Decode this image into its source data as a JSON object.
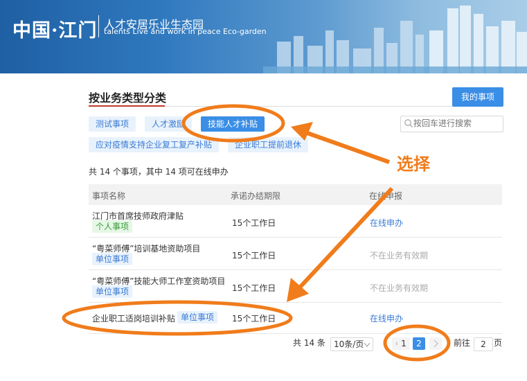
{
  "header": {
    "logo": "中国·江门",
    "slogan_cn": "人才安居乐业生态园",
    "slogan_en": "talents Live and work in peace Eco-garden"
  },
  "section": {
    "title": "按业务类型分类",
    "my_items_button": "我的事项"
  },
  "tags": [
    {
      "label": "测试事项",
      "active": false
    },
    {
      "label": "人才激励",
      "active": false
    },
    {
      "label": "技能人才补贴",
      "active": true
    },
    {
      "label": "应对疫情支持企业复工复产补贴",
      "active": false
    },
    {
      "label": "企业职工提前退休",
      "active": false
    }
  ],
  "search": {
    "placeholder": "按回车进行搜索"
  },
  "summary": "共 14 个事项，其中 14 项可在线申办",
  "table": {
    "headers": [
      "事项名称",
      "承诺办结期限",
      "在线申报"
    ],
    "rows": [
      {
        "name": "江门市首席技师政府津贴",
        "badge": "个人事项",
        "deadline": "15个工作日",
        "action": "在线申办"
      },
      {
        "name": "“粤菜师傅”培训基地资助项目",
        "badge": "单位事项",
        "deadline": "15个工作日",
        "action": "不在业务有效期"
      },
      {
        "name": "“粤菜师傅”技能大师工作室资助项目",
        "badge": "单位事项",
        "deadline": "15个工作日",
        "action": "不在业务有效期"
      },
      {
        "name": "企业职工适岗培训补贴",
        "badge": "单位事项",
        "deadline": "15个工作日",
        "action": "在线申办"
      }
    ]
  },
  "pagination": {
    "total": "共 14 条",
    "page_size": "10条/页",
    "pages": [
      "1",
      "2"
    ],
    "current_page": 2,
    "goto_prefix": "前往",
    "goto_value": "2",
    "goto_suffix": "页"
  },
  "annotation": {
    "text": "选择",
    "color": "#f07c1b"
  },
  "colors": {
    "primary": "#3a8ee6",
    "tag_bg": "#e8f2fc",
    "section_underline": "#c0392b",
    "annotation": "#f07c1b"
  }
}
